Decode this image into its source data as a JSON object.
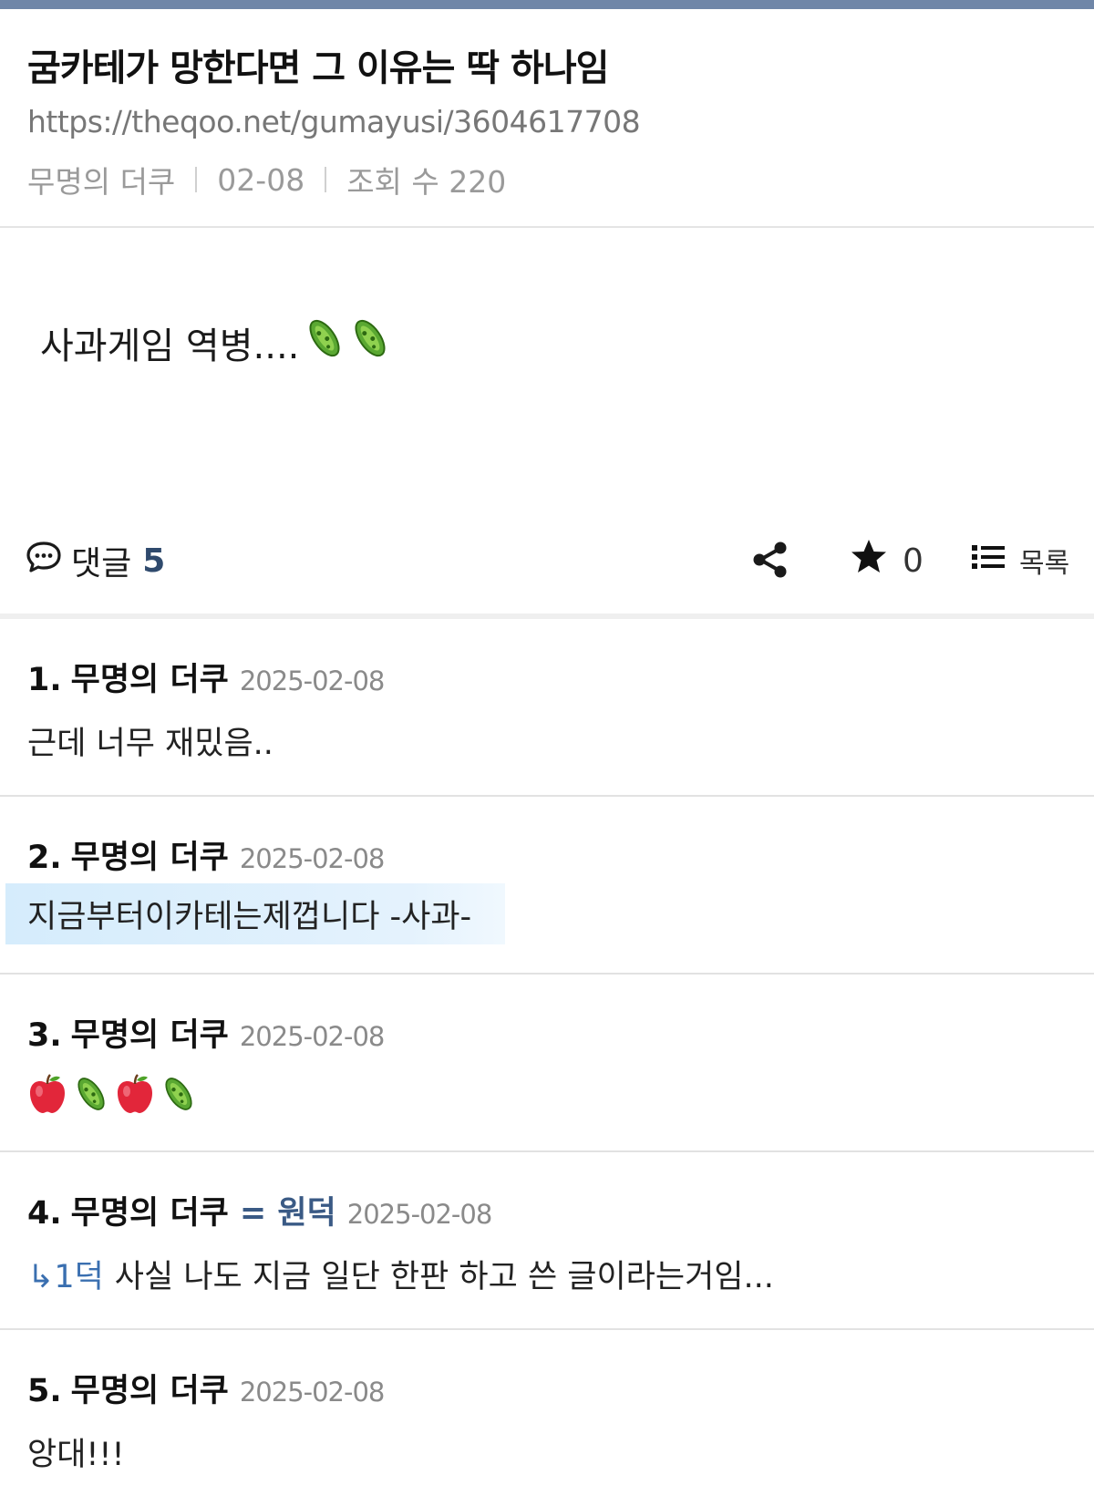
{
  "post": {
    "title": "굼카테가 망한다면 그 이유는 딱 하나임",
    "url": "https://theqoo.net/gumayusi/3604617708",
    "author": "무명의 더쿠",
    "date": "02-08",
    "views_label": "조회 수 220",
    "body": "사과게임 역병....",
    "body_icons": [
      "microbe-icon",
      "microbe-icon"
    ]
  },
  "actions": {
    "comment_label": "댓글",
    "comment_count": "5",
    "star_count": "0",
    "list_label": "목록"
  },
  "comments": [
    {
      "num": "1.",
      "author": "무명의 더쿠",
      "badge": "",
      "date": "2025-02-08",
      "body": "근데 너무 재밌음.."
    },
    {
      "num": "2.",
      "author": "무명의 더쿠",
      "badge": "",
      "date": "2025-02-08",
      "body": "지금부터이카테는제껍니다 -사과-"
    },
    {
      "num": "3.",
      "author": "무명의 더쿠",
      "badge": "",
      "date": "2025-02-08",
      "body": "",
      "icons": [
        "apple-icon",
        "microbe-icon",
        "apple-icon",
        "microbe-icon"
      ]
    },
    {
      "num": "4.",
      "author": "무명의 더쿠",
      "badge": "= 원덕",
      "date": "2025-02-08",
      "ref": "↳1덕",
      "body": "사실 나도 지금 일단 한판 하고 쓴 글이라는거임..."
    },
    {
      "num": "5.",
      "author": "무명의 더쿠",
      "badge": "",
      "date": "2025-02-08",
      "body": "앙대!!!"
    }
  ],
  "colors": {
    "topbar": "#6f86a8",
    "comment_count": "#2f4a6d",
    "op_badge": "#3a5a85",
    "reply_ref": "#3a6fb0",
    "highlight": "#d5ecfc"
  }
}
